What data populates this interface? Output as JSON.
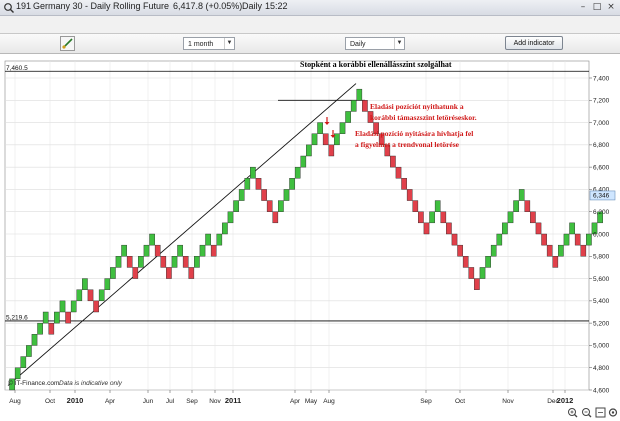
{
  "window": {
    "title_code": "191",
    "instrument": "Germany 30 - Daily Rolling Future",
    "price": "6,417.8 (+0.05%)",
    "timeframe": "Daily",
    "time": "15:22"
  },
  "toolbar": {
    "period_value": "1 month",
    "interval_value": "Daily",
    "add_indicator_label": "Add indicator"
  },
  "colors": {
    "up": "#3fbf3f",
    "down": "#e0404a",
    "accent_box": "#cfe6ff"
  },
  "icons": [
    "app-icon",
    "minimize-icon",
    "maximize-icon",
    "close-icon",
    "draw-tool-icon",
    "zoom-in-icon",
    "zoom-out-icon",
    "fit-icon",
    "settings-icon"
  ],
  "chart_data": {
    "type": "renko",
    "box_size": 100,
    "ylim": [
      4500,
      7600
    ],
    "y_ticks": [
      4600,
      4800,
      5000,
      5200,
      5400,
      5600,
      5800,
      6000,
      6200,
      6400,
      6600,
      6800,
      7000,
      7200,
      7400
    ],
    "y_tick_labels": [
      "4,600",
      "4,800",
      "5,000",
      "5,200",
      "5,400",
      "5,600",
      "5,800",
      "6,000",
      "6,200",
      "6,400",
      "6,600",
      "6,800",
      "7,000",
      "7,200",
      "7,400"
    ],
    "x_tick_labels": [
      "Aug",
      "Oct",
      "2010",
      "Apr",
      "Jun",
      "Jul",
      "Sep",
      "Nov",
      "2011",
      "Apr",
      "May",
      "Aug",
      "Sep",
      "Oct",
      "Nov",
      "Dec",
      "2012"
    ],
    "bold_x_labels": [
      "2010",
      "2011",
      "2012"
    ],
    "horizontal_levels": [
      {
        "value": 7460.5,
        "label": "7,460.5"
      },
      {
        "value": 5219.6,
        "label": "5,219.6"
      }
    ],
    "last_price_label": "6,346",
    "bricks": [
      1,
      1,
      1,
      1,
      1,
      1,
      1,
      -1,
      1,
      1,
      -1,
      1,
      1,
      1,
      -1,
      -1,
      1,
      1,
      1,
      1,
      1,
      -1,
      -1,
      1,
      1,
      1,
      -1,
      -1,
      -1,
      1,
      1,
      -1,
      -1,
      1,
      1,
      1,
      -1,
      1,
      1,
      1,
      1,
      1,
      1,
      1,
      -1,
      -1,
      -1,
      -1,
      1,
      1,
      1,
      1,
      1,
      1,
      1,
      1,
      -1,
      -1,
      1,
      1,
      1,
      1,
      1,
      -1,
      -1,
      -1,
      -1,
      -1,
      -1,
      -1,
      -1,
      -1,
      -1,
      -1,
      -1,
      1,
      1,
      -1,
      -1,
      -1,
      -1,
      -1,
      -1,
      -1,
      1,
      1,
      1,
      1,
      1,
      1,
      1,
      1,
      -1,
      -1,
      -1,
      -1,
      -1,
      -1,
      1,
      1,
      1,
      -1,
      -1,
      1,
      1,
      1
    ],
    "start_value": 4700,
    "annotations": [
      "Stopként a korábbi ellenállásszint szolgálhat",
      "Eladási pozíciót nyithatunk a",
      "korábbi támaszszint letöréseskor.",
      "Eladási pozíció nyitására hívhatja fel",
      "a figyelmet a trendvonal letörése"
    ],
    "footer": "© IT-Finance.com",
    "footer_note": "Data is indicative only"
  }
}
